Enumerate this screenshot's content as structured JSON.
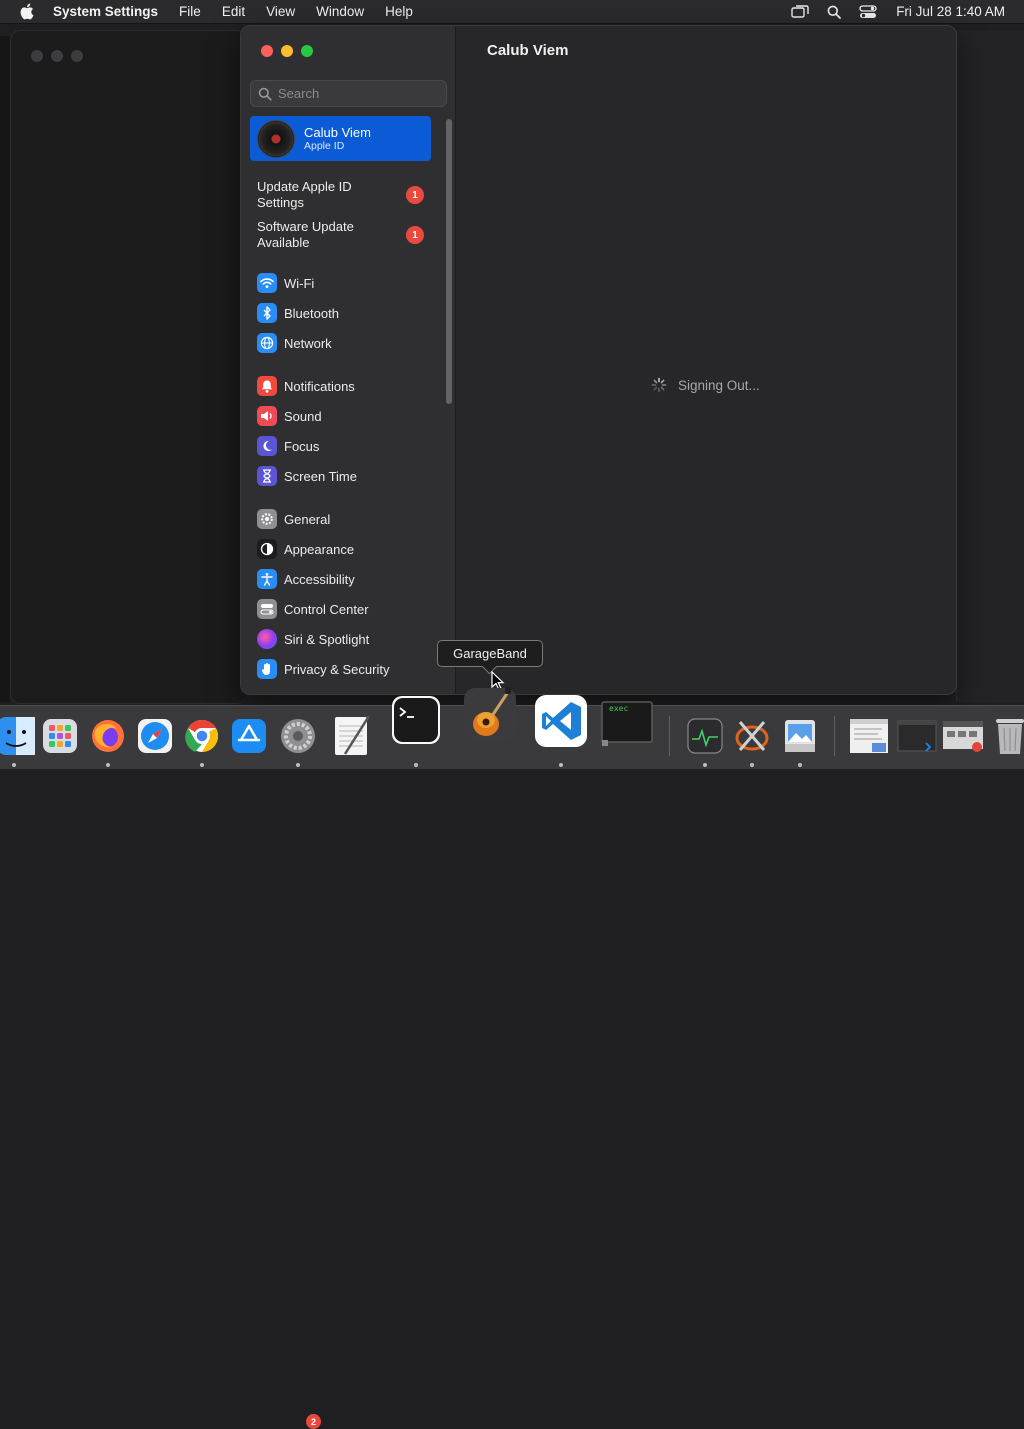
{
  "menubar": {
    "app_name": "System Settings",
    "menus": [
      "File",
      "Edit",
      "View",
      "Window",
      "Help"
    ],
    "clock": "Fri Jul 28  1:40 AM"
  },
  "search": {
    "placeholder": "Search"
  },
  "account": {
    "name": "Calub Viem",
    "subtitle": "Apple ID"
  },
  "alerts": [
    {
      "label_line1": "Update Apple ID",
      "label_line2": "Settings",
      "count": "1"
    },
    {
      "label_line1": "Software Update",
      "label_line2": "Available",
      "count": "1"
    }
  ],
  "sidebar_groups": [
    [
      {
        "label": "Wi-Fi",
        "icon": "wifi-icon",
        "color": "#2a8cf5"
      },
      {
        "label": "Bluetooth",
        "icon": "bluetooth-icon",
        "color": "#2a8cf5"
      },
      {
        "label": "Network",
        "icon": "globe-icon",
        "color": "#2a8cf5"
      }
    ],
    [
      {
        "label": "Notifications",
        "icon": "bell-icon",
        "color": "#f04a3f"
      },
      {
        "label": "Sound",
        "icon": "speaker-icon",
        "color": "#f04a57"
      },
      {
        "label": "Focus",
        "icon": "moon-icon",
        "color": "#5b55d6"
      },
      {
        "label": "Screen Time",
        "icon": "hourglass-icon",
        "color": "#5b55d6"
      }
    ],
    [
      {
        "label": "General",
        "icon": "gear-icon",
        "color": "#8e8e93"
      },
      {
        "label": "Appearance",
        "icon": "appearance-icon",
        "color": "#1c1c1e"
      },
      {
        "label": "Accessibility",
        "icon": "accessibility-icon",
        "color": "#2a8cf5"
      },
      {
        "label": "Control Center",
        "icon": "control-center-icon",
        "color": "#8e8e93"
      },
      {
        "label": "Siri & Spotlight",
        "icon": "siri-icon",
        "color": "#b03cc9"
      },
      {
        "label": "Privacy & Security",
        "icon": "hand-icon",
        "color": "#2a8cf5"
      }
    ]
  ],
  "content": {
    "title": "Calub Viem",
    "status": "Signing Out..."
  },
  "tooltip": "GarageBand",
  "dock": {
    "apps": [
      {
        "name": "finder",
        "running": true
      },
      {
        "name": "launchpad",
        "running": false
      },
      {
        "name": "firefox",
        "running": true
      },
      {
        "name": "safari",
        "running": false
      },
      {
        "name": "chrome",
        "running": true
      },
      {
        "name": "app-store",
        "running": false
      },
      {
        "name": "system-settings",
        "running": true,
        "badge": "2"
      },
      {
        "name": "textedit",
        "running": false
      },
      {
        "name": "terminal",
        "running": true
      },
      {
        "name": "garageband",
        "running": false
      },
      {
        "name": "vscode",
        "running": true
      },
      {
        "name": "exec-console",
        "running": false
      },
      {
        "name": "activity-monitor",
        "running": true
      },
      {
        "name": "x11-tool",
        "running": true
      },
      {
        "name": "preview",
        "running": true
      },
      {
        "name": "minimized-window-1",
        "running": false
      },
      {
        "name": "minimized-window-2",
        "running": false
      },
      {
        "name": "minimized-window-3",
        "running": false
      },
      {
        "name": "trash",
        "running": false
      }
    ],
    "exec_label": "exec"
  }
}
